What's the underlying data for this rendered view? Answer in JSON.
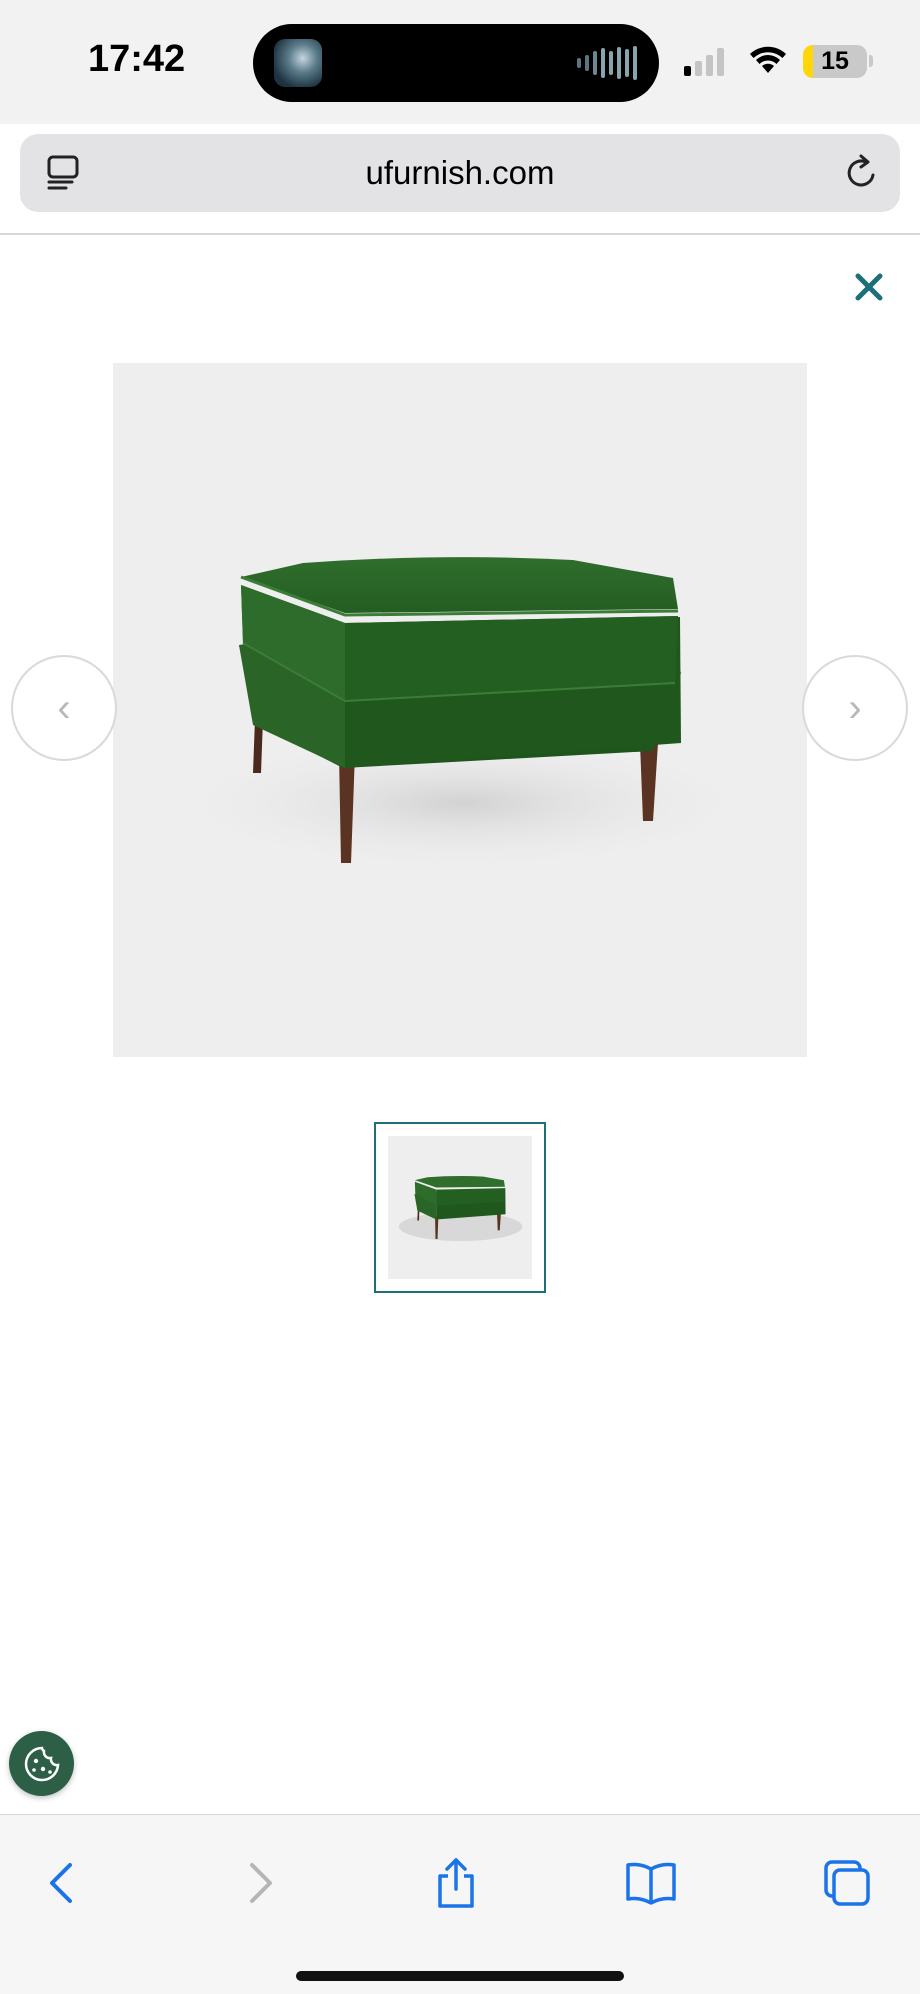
{
  "status_bar": {
    "time": "17:42",
    "battery_level": "15",
    "battery_fraction": 0.15,
    "signal_bars_active": 1,
    "signal_bars_total": 4
  },
  "browser": {
    "url": "ufurnish.com",
    "reader_icon": "reader-mode-icon",
    "reload_icon": "reload-icon"
  },
  "gallery": {
    "close_icon": "close-icon",
    "close_symbol": "✕",
    "prev_symbol": "‹",
    "next_symbol": "›",
    "main_image_alt": "green-velvet-ottoman",
    "thumbnail_count": 1,
    "selected_thumbnail": 0,
    "accent_color": "#1d6f7a"
  },
  "cookie": {
    "icon": "cookie-icon",
    "color": "#2c5f46"
  },
  "toolbar": {
    "back_icon": "chevron-left-icon",
    "forward_icon": "chevron-right-icon",
    "share_icon": "share-icon",
    "bookmarks_icon": "book-icon",
    "tabs_icon": "tabs-icon",
    "active_color": "#1a73e8",
    "disabled_color": "#b5b5b5"
  }
}
